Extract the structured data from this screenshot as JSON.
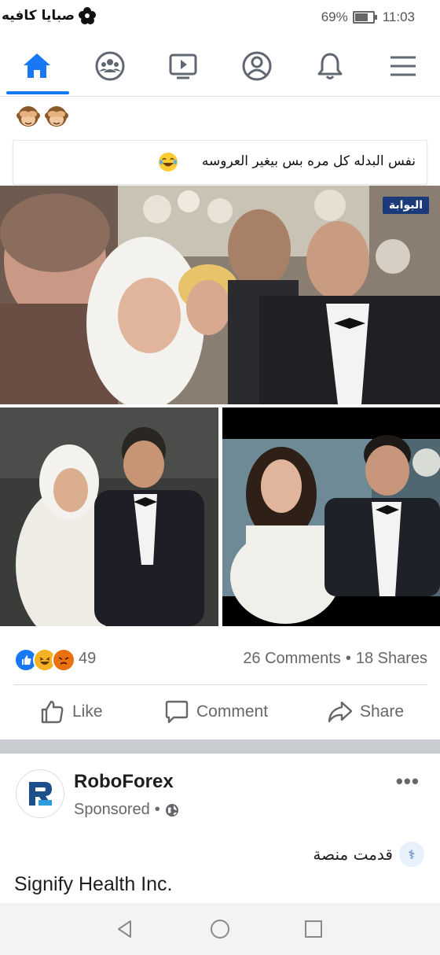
{
  "status_bar": {
    "watermark": "صبايا كافيه",
    "battery_label": "69%",
    "battery_level": 0.69,
    "time": "11:03"
  },
  "nav": {
    "tabs": [
      {
        "name": "home",
        "icon": "home-icon",
        "active": true
      },
      {
        "name": "groups",
        "icon": "groups-icon",
        "active": false
      },
      {
        "name": "watch",
        "icon": "video-icon",
        "active": false
      },
      {
        "name": "profile",
        "icon": "profile-icon",
        "active": false
      },
      {
        "name": "notifications",
        "icon": "bell-icon",
        "active": false
      },
      {
        "name": "menu",
        "icon": "menu-icon",
        "active": false
      }
    ],
    "active_color": "#1877f2"
  },
  "post": {
    "header_emojis": [
      "see-no-evil-monkey-icon",
      "see-no-evil-monkey-icon"
    ],
    "caption": "نفس البدله كل مره بس بيغير العروسه",
    "caption_emoji": "tears-of-joy-icon",
    "photo_badge": "البوابة",
    "reaction_icons": [
      "like-reaction-icon",
      "haha-reaction-icon",
      "angry-reaction-icon"
    ],
    "reaction_count": "49",
    "comments": "26 Comments",
    "stats_separator": "•",
    "shares": "18 Shares",
    "actions": {
      "like": "Like",
      "comment": "Comment",
      "share": "Share"
    }
  },
  "ad": {
    "name": "RoboForex",
    "sponsored": "Sponsored",
    "sponsored_separator": "•",
    "more": "•••",
    "line1": "قدمت منصة",
    "line2": "Signify Health Inc."
  },
  "system_nav": {
    "buttons": [
      "back-icon",
      "home-circle-icon",
      "recents-square-icon"
    ]
  }
}
